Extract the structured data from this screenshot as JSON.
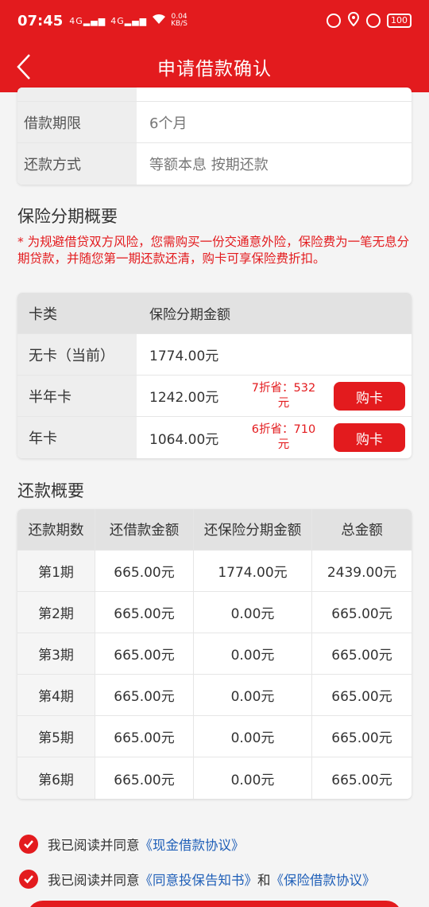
{
  "status_bar": {
    "time": "07:45",
    "signal1": "4G",
    "signal2": "4G",
    "speed_value": "0.04",
    "speed_unit": "KB/S",
    "battery": "100",
    "icons": [
      "lock-icon",
      "location-icon",
      "alarm-icon"
    ]
  },
  "nav": {
    "title": "申请借款确认",
    "back_icon": "chevron-left-icon"
  },
  "loan_info": {
    "rows": [
      {
        "label": "借款期限",
        "value": "6个月"
      },
      {
        "label": "还款方式",
        "value": "等额本息 按期还款"
      }
    ]
  },
  "insurance": {
    "title": "保险分期概要",
    "notice": "* 为规避借贷双方风险，您需购买一份交通意外险，保险费为一笔无息分期贷款，并随您第一期还款还清，购卡可享保险费折扣。",
    "header": {
      "col1": "卡类",
      "col2": "保险分期金额"
    },
    "rows": [
      {
        "card": "无卡（当前）",
        "amount": "1774.00元"
      },
      {
        "card": "半年卡",
        "amount": "1242.00元",
        "discount_line1": "7折省：532",
        "discount_line2": "元",
        "button": "购卡"
      },
      {
        "card": "年卡",
        "amount": "1064.00元",
        "discount_line1": "6折省：710",
        "discount_line2": "元",
        "button": "购卡"
      }
    ]
  },
  "repayment": {
    "title": "还款概要",
    "headers": [
      "还款期数",
      "还借款金额",
      "还保险分期金额",
      "总金额"
    ],
    "rows": [
      [
        "第1期",
        "665.00元",
        "1774.00元",
        "2439.00元"
      ],
      [
        "第2期",
        "665.00元",
        "0.00元",
        "665.00元"
      ],
      [
        "第3期",
        "665.00元",
        "0.00元",
        "665.00元"
      ],
      [
        "第4期",
        "665.00元",
        "0.00元",
        "665.00元"
      ],
      [
        "第5期",
        "665.00元",
        "0.00元",
        "665.00元"
      ],
      [
        "第6期",
        "665.00元",
        "0.00元",
        "665.00元"
      ]
    ]
  },
  "agreements": {
    "line1_prefix": "我已阅读并同意",
    "line1_link": "《现金借款协议》",
    "line2_prefix": "我已阅读并同意",
    "line2_link1": "《同意投保告知书》",
    "line2_mid": "和",
    "line2_link2": "《保险借款协议》"
  },
  "colors": {
    "brand_red": "#e31b1e",
    "link_blue": "#1f5fb8"
  }
}
